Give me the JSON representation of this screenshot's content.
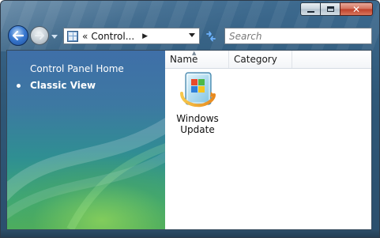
{
  "window": {
    "caption_buttons": [
      "minimize",
      "maximize",
      "close"
    ],
    "close_glyph": "✕"
  },
  "navigation": {
    "address_chevron": "«",
    "address_text": "Control...",
    "address_arrow": "▶",
    "search_placeholder": "Search"
  },
  "left_pane": {
    "items": [
      {
        "label": "Control Panel Home",
        "selected": false
      },
      {
        "label": "Classic View",
        "selected": true
      }
    ]
  },
  "columns": {
    "name": "Name",
    "category": "Category",
    "sort_indicator": "▲"
  },
  "items": [
    {
      "label": "Windows Update",
      "icon": "windows-update-icon"
    }
  ],
  "colors": {
    "frame": "#2f5878",
    "pane_blue": "#3f6fa8",
    "pane_green": "#4cae5e",
    "close_red": "#bf3f28"
  }
}
